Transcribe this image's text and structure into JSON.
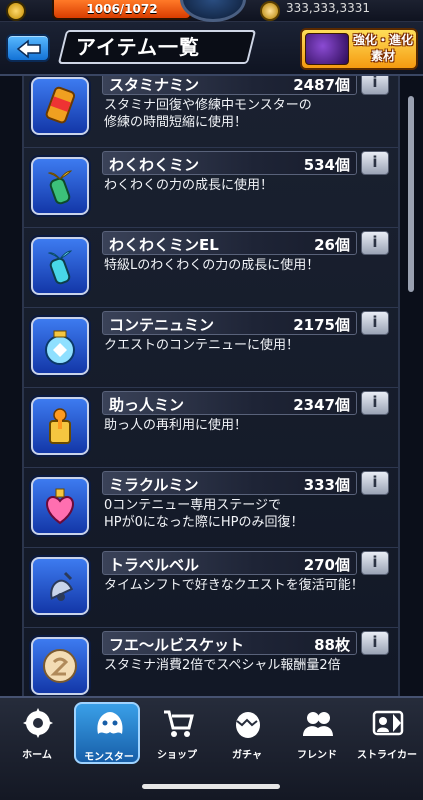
{
  "topbar": {
    "stamina_text": "1006/1072",
    "coin_text": "333,333,3331",
    "stamina_color": "#ff7a28"
  },
  "header": {
    "title": "アイテム一覧",
    "back_icon": "back-arrow-icon",
    "evolve_button_text": "強化・進化\n素材"
  },
  "items": [
    {
      "name": "スタミナミン",
      "count": "2487個",
      "desc": "スタミナ回復や修練中モンスターの\n修練の時間短縮に使用！",
      "icon": "can-icon"
    },
    {
      "name": "わくわくミン",
      "count": "534個",
      "desc": "わくわくの力の成長に使用！",
      "icon": "sprout-bottle-icon"
    },
    {
      "name": "わくわくミンEL",
      "count": "26個",
      "desc": "特級Lのわくわくの力の成長に使用！",
      "icon": "sprout-bottle-el-icon"
    },
    {
      "name": "コンテニュミン",
      "count": "2175個",
      "desc": "クエストのコンテニューに使用！",
      "icon": "continue-jar-icon"
    },
    {
      "name": "助っ人ミン",
      "count": "2347個",
      "desc": "助っ人の再利用に使用！",
      "icon": "helper-bottle-icon"
    },
    {
      "name": "ミラクルミン",
      "count": "333個",
      "desc": "0コンテニュー専用ステージで\nHPが0になった際にHPのみ回復！",
      "icon": "heart-potion-icon"
    },
    {
      "name": "トラベルベル",
      "count": "270個",
      "desc": "タイムシフトで好きなクエストを復活可能！",
      "icon": "bell-icon"
    },
    {
      "name": "フエ〜ルビスケット",
      "count": "88枚",
      "desc": "スタミナ消費2倍でスペシャル報酬量2倍",
      "icon": "biscuit-icon"
    }
  ],
  "info_label": "i",
  "nav": [
    {
      "label": "ホーム",
      "icon": "home-icon"
    },
    {
      "label": "モンスター",
      "icon": "monster-icon",
      "active": true
    },
    {
      "label": "ショップ",
      "icon": "cart-icon"
    },
    {
      "label": "ガチャ",
      "icon": "egg-icon"
    },
    {
      "label": "フレンド",
      "icon": "friends-icon"
    },
    {
      "label": "ストライカー",
      "icon": "striker-card-icon"
    }
  ]
}
